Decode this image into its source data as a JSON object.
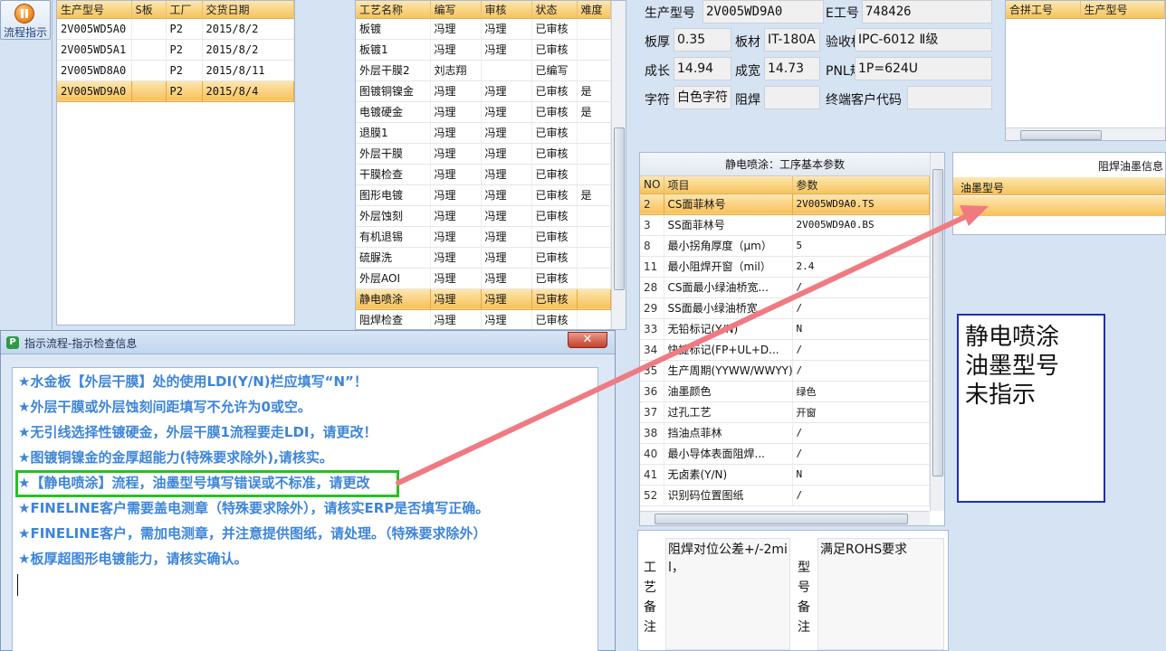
{
  "sidebar": {
    "icon": "flow-icon",
    "label": "流程指示"
  },
  "models_grid": {
    "headers": [
      "生产型号",
      "S板",
      "工厂",
      "交货日期"
    ],
    "rows": [
      [
        "2V005WD5A0",
        "",
        "P2",
        "2015/8/2"
      ],
      [
        "2V005WD5A1",
        "",
        "P2",
        "2015/8/2"
      ],
      [
        "2V005WD8A0",
        "",
        "P2",
        "2015/8/11"
      ],
      [
        "2V005WD9A0",
        "",
        "P2",
        "2015/8/4"
      ]
    ],
    "selected": 3
  },
  "process_grid": {
    "headers": [
      "工艺名称",
      "编写",
      "审核",
      "状态",
      "难度"
    ],
    "rows": [
      [
        "板镀",
        "冯理",
        "冯理",
        "已审核",
        ""
      ],
      [
        "板镀1",
        "冯理",
        "冯理",
        "已审核",
        ""
      ],
      [
        "外层干膜2",
        "刘志翔",
        "",
        "已编写",
        ""
      ],
      [
        "图镀铜镍金",
        "冯理",
        "冯理",
        "已审核",
        "是"
      ],
      [
        "电镀硬金",
        "冯理",
        "冯理",
        "已审核",
        "是"
      ],
      [
        "退膜1",
        "冯理",
        "冯理",
        "已审核",
        ""
      ],
      [
        "外层干膜",
        "冯理",
        "冯理",
        "已审核",
        ""
      ],
      [
        "干膜检查",
        "冯理",
        "冯理",
        "已审核",
        ""
      ],
      [
        "图形电镀",
        "冯理",
        "冯理",
        "已审核",
        "是"
      ],
      [
        "外层蚀刻",
        "冯理",
        "冯理",
        "已审核",
        ""
      ],
      [
        "有机退锡",
        "冯理",
        "冯理",
        "已审核",
        ""
      ],
      [
        "硫脲洗",
        "冯理",
        "冯理",
        "已审核",
        ""
      ],
      [
        "外层AOI",
        "冯理",
        "冯理",
        "已审核",
        ""
      ],
      [
        "静电喷涂",
        "冯理",
        "冯理",
        "已审核",
        ""
      ],
      [
        "阻焊检查",
        "冯理",
        "冯理",
        "已审核",
        ""
      ]
    ],
    "selected": 13
  },
  "info": {
    "model_label": "生产型号",
    "model_value": "2V005WD9A0",
    "e_label": "E工号",
    "e_value": "748426",
    "thick_label": "板厚",
    "thick_value": "0.35",
    "material_label": "板材",
    "material_value": "IT-180A",
    "std_label": "验收标准",
    "std_value": "IPC-6012 Ⅱ级",
    "length_label": "成长",
    "length_value": "14.94",
    "width_label": "成宽",
    "width_value": "14.73",
    "pnl_label": "PNL规格",
    "pnl_value": "1P=624U",
    "char_label": "字符",
    "char_value": "白色字符",
    "mask_label": "阻焊",
    "mask_value": "",
    "cust_label": "终端客户代码",
    "cust_value": ""
  },
  "combine_grid": {
    "headers": [
      "合拼工号",
      "生产型号"
    ]
  },
  "params": {
    "title": "静电喷涂：工序基本参数",
    "headers": [
      "NO",
      "项目",
      "参数"
    ],
    "rows": [
      [
        "2",
        "CS面菲林号",
        "2V005WD9A0.TS"
      ],
      [
        "3",
        "SS面菲林号",
        "2V005WD9A0.BS"
      ],
      [
        "8",
        "最小拐角厚度（μm）",
        "5"
      ],
      [
        "11",
        "最小阻焊开窗（mil）",
        "2.4"
      ],
      [
        "28",
        "CS面最小绿油桥宽...",
        "/"
      ],
      [
        "29",
        "SS面最小绿油桥宽...",
        "/"
      ],
      [
        "33",
        "无铅标记(Y/N)",
        "N"
      ],
      [
        "34",
        "快捷标记(FP+UL+D...",
        "/"
      ],
      [
        "35",
        "生产周期(YYWW/WWYY)",
        "/"
      ],
      [
        "36",
        "油墨颜色",
        "绿色"
      ],
      [
        "37",
        "过孔工艺",
        "开窗"
      ],
      [
        "38",
        "挡油点菲林",
        "/"
      ],
      [
        "40",
        "最小导体表面阻焊...",
        "/"
      ],
      [
        "41",
        "无卤素(Y/N)",
        "N"
      ],
      [
        "52",
        "识别码位置图纸",
        "/"
      ]
    ],
    "selected": 0
  },
  "ink": {
    "title": "阻焊油墨信息",
    "header": "油墨型号"
  },
  "annotation": "静电喷涂\n油墨型号\n未指示",
  "notes": {
    "process_label": "工艺备注",
    "process_text": "阻焊对位公差+/-2mil，",
    "model_label": "型号备注",
    "model_text": "满足ROHS要求"
  },
  "dialog": {
    "title": "指示流程-指示检查信息",
    "messages": [
      "★水金板【外层干膜】处的使用LDI(Y/N)栏应填写“N”！",
      "★外层干膜或外层蚀刻间距填写不允许为0或空。",
      "★无引线选择性镀硬金，外层干膜1流程要走LDI，请更改！",
      "★图镀铜镍金的金厚超能力(特殊要求除外),请核实。",
      "★【静电喷涂】流程，油墨型号填写错误或不标准，请更改",
      "★FINELINE客户需要盖电测章（特殊要求除外），请核实ERP是否填写正确。",
      "★FINELINE客户，需加电测章，并注意提供图纸，请处理。（特殊要求除外）",
      "★板厚超图形电镀能力，请核实确认。"
    ],
    "highlight_index": 4
  },
  "colors": {
    "accent_orange": "#f6c35c",
    "message_blue": "#3d85d9",
    "highlight_green": "#22c41e",
    "annotation_arrow": "#f07a82",
    "annotation_border": "#1f2fb0"
  }
}
